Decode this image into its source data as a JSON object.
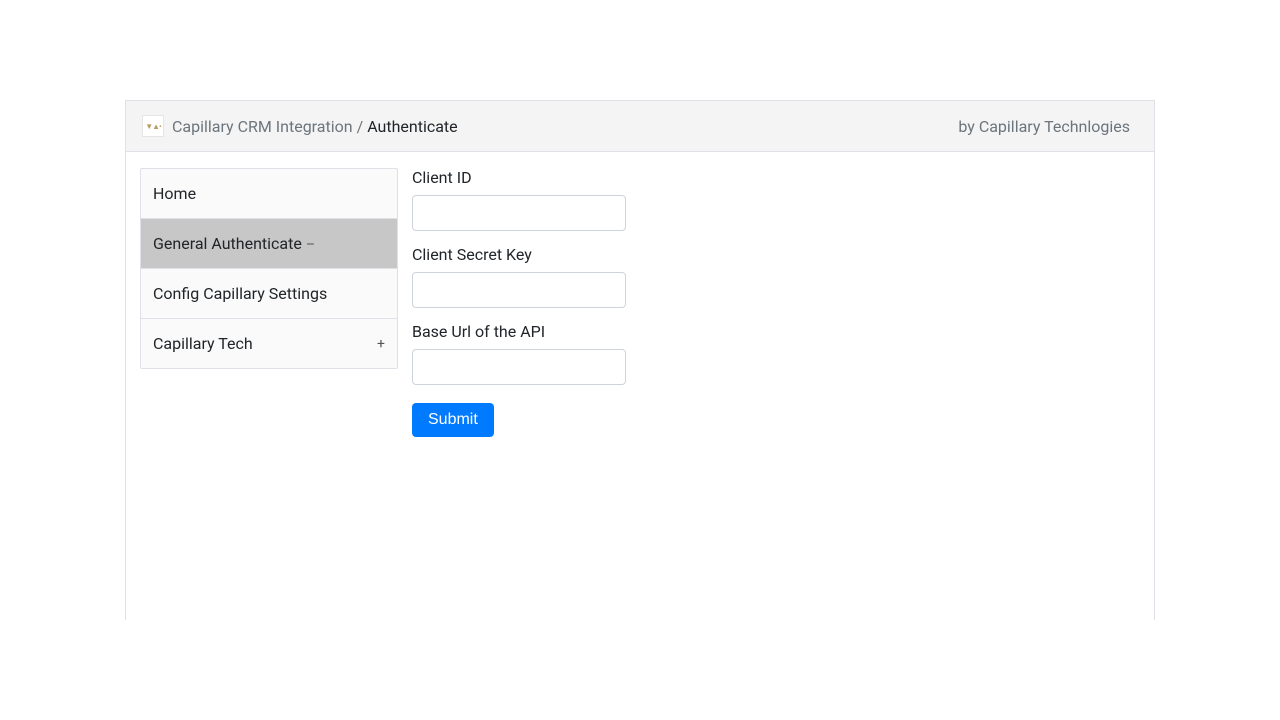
{
  "header": {
    "app_name": "Capillary CRM Integration",
    "page_name": "Authenticate",
    "separator": "/",
    "vendor_text": "by Capillary Technlogies"
  },
  "sidebar": {
    "items": [
      {
        "label": "Home",
        "expand": ""
      },
      {
        "label": "General Authenticate",
        "expand": "–"
      },
      {
        "label": "Config Capillary Settings",
        "expand": ""
      },
      {
        "label": "Capillary Tech",
        "expand": "+"
      }
    ]
  },
  "form": {
    "client_id_label": "Client ID",
    "client_secret_label": "Client Secret Key",
    "base_url_label": "Base Url of the API",
    "submit_label": "Submit",
    "client_id_value": "",
    "client_secret_value": "",
    "base_url_value": ""
  }
}
